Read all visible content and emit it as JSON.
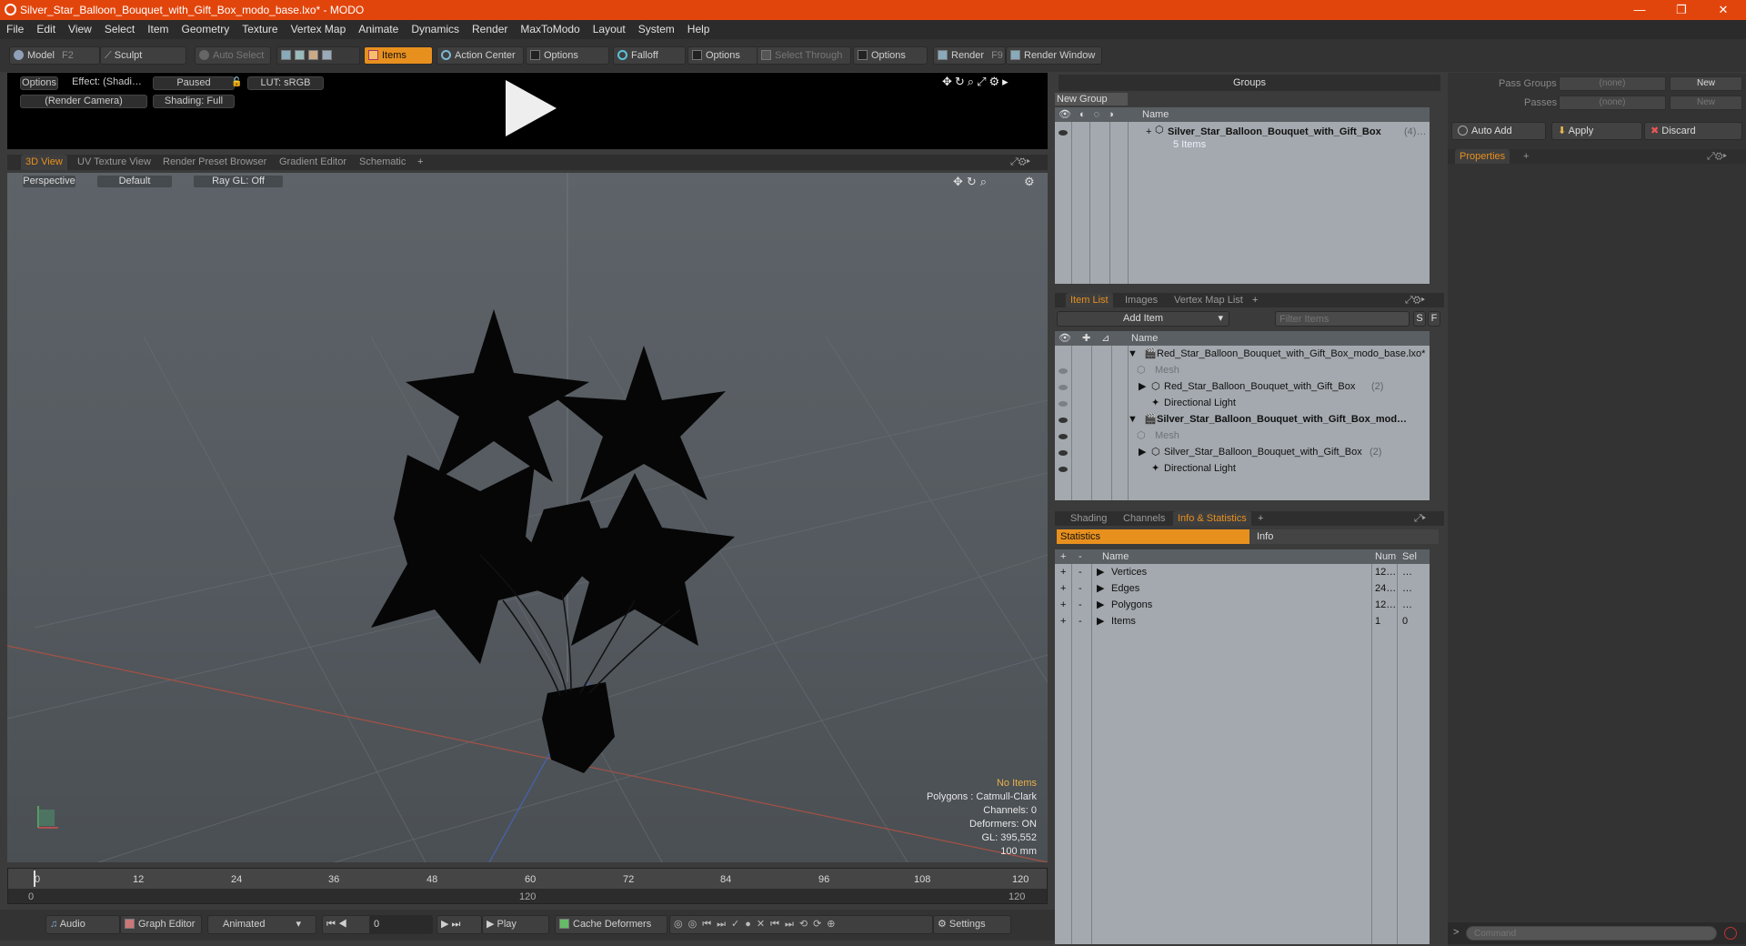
{
  "window": {
    "title": "Silver_Star_Balloon_Bouquet_with_Gift_Box_modo_base.lxo* - MODO",
    "minimize": "—",
    "maximize": "❐",
    "close": "✕"
  },
  "menu": [
    "File",
    "Edit",
    "View",
    "Select",
    "Item",
    "Geometry",
    "Texture",
    "Vertex Map",
    "Animate",
    "Dynamics",
    "Render",
    "MaxToModo",
    "Layout",
    "System",
    "Help"
  ],
  "toolbar": {
    "model": "Model",
    "model_hotkey": "F2",
    "sculpt": "Sculpt",
    "auto_select": "Auto Select",
    "items": "Items",
    "action_center": "Action Center",
    "options1": "Options",
    "falloff": "Falloff",
    "options2": "Options",
    "select_through": "Select Through",
    "options3": "Options",
    "render": "Render",
    "render_hotkey": "F9",
    "render_window": "Render Window"
  },
  "preview": {
    "options": "Options",
    "effect": "Effect: (Shadi…",
    "paused": "Paused",
    "lut": "LUT: sRGB",
    "camera": "(Render Camera)",
    "shading": "Shading: Full"
  },
  "view_tabs": [
    "3D View",
    "UV Texture View",
    "Render Preset Browser",
    "Gradient Editor",
    "Schematic"
  ],
  "viewport": {
    "perspective": "Perspective",
    "default": "Default",
    "raygl": "Ray GL: Off",
    "stats": {
      "no_items": "No Items",
      "polygons": "Polygons : Catmull-Clark",
      "channels": "Channels: 0",
      "deformers": "Deformers: ON",
      "gl": "GL: 395,552",
      "scale": "100 mm"
    }
  },
  "timeline": {
    "ticks": [
      "0",
      "12",
      "24",
      "36",
      "48",
      "60",
      "72",
      "84",
      "96",
      "108",
      "120"
    ],
    "start": "0",
    "mid": "120",
    "end": "120"
  },
  "bottom": {
    "audio": "Audio",
    "graph_editor": "Graph Editor",
    "animated": "Animated",
    "frame": "0",
    "play": "Play",
    "cache_deformers": "Cache Deformers",
    "settings": "Settings"
  },
  "groups": {
    "title": "Groups",
    "new_group": "New Group",
    "name_col": "Name",
    "item_name": "Silver_Star_Balloon_Bouquet_with_Gift_Box",
    "item_count": "(4)…",
    "item_sub": "5 Items"
  },
  "pass": {
    "pass_groups": "Pass Groups",
    "passes": "Passes",
    "none1": "(none)",
    "none2": "(none)",
    "new1": "New",
    "new2": "New",
    "auto_add": "Auto Add",
    "apply": "Apply",
    "discard": "Discard",
    "properties": "Properties"
  },
  "itemlist": {
    "tabs": [
      "Item List",
      "Images",
      "Vertex Map List"
    ],
    "add_item": "Add Item",
    "filter": "Filter Items",
    "s": "S",
    "f": "F",
    "name_col": "Name",
    "rows": [
      {
        "label": "Red_Star_Balloon_Bouquet_with_Gift_Box_modo_base.lxo*",
        "count": ""
      },
      {
        "label": "Mesh",
        "count": ""
      },
      {
        "label": "Red_Star_Balloon_Bouquet_with_Gift_Box",
        "count": "(2)"
      },
      {
        "label": "Directional Light",
        "count": ""
      },
      {
        "label": "Silver_Star_Balloon_Bouquet_with_Gift_Box_mod…",
        "count": ""
      },
      {
        "label": "Mesh",
        "count": ""
      },
      {
        "label": "Silver_Star_Balloon_Bouquet_with_Gift_Box",
        "count": "(2)"
      },
      {
        "label": "Directional Light",
        "count": ""
      }
    ]
  },
  "info": {
    "tabs": [
      "Shading",
      "Channels",
      "Info & Statistics"
    ],
    "statistics": "Statistics",
    "info": "Info",
    "col_name": "Name",
    "col_num": "Num",
    "col_sel": "Sel",
    "rows": [
      {
        "name": "Vertices",
        "num": "12…",
        "sel": "…"
      },
      {
        "name": "Edges",
        "num": "24…",
        "sel": "…"
      },
      {
        "name": "Polygons",
        "num": "12…",
        "sel": "…"
      },
      {
        "name": "Items",
        "num": "1",
        "sel": "0"
      }
    ]
  },
  "command": {
    "placeholder": "Command"
  }
}
